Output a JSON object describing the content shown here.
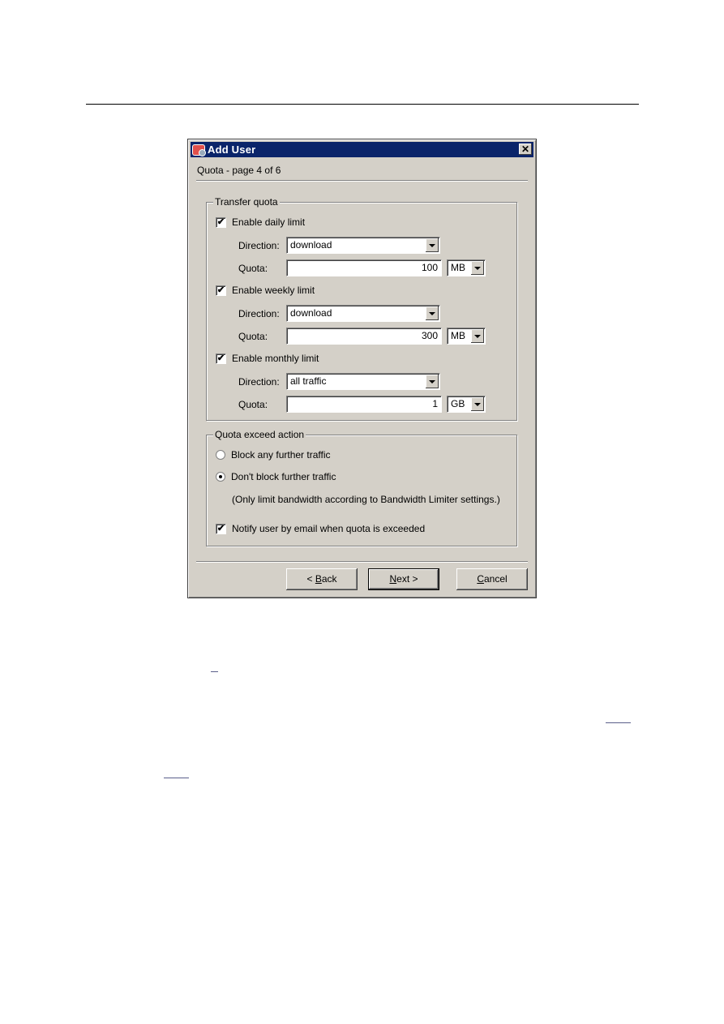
{
  "dialog": {
    "title": "Add User",
    "close_label": "✕",
    "subtitle": "Quota - page 4 of 6",
    "transfer_quota": {
      "legend": "Transfer quota",
      "limits": [
        {
          "checkbox_label": "Enable daily limit",
          "checked": true,
          "direction_label": "Direction:",
          "direction_value": "download",
          "quota_label": "Quota:",
          "quota_value": "100",
          "unit": "MB"
        },
        {
          "checkbox_label": "Enable weekly limit",
          "checked": true,
          "direction_label": "Direction:",
          "direction_value": "download",
          "quota_label": "Quota:",
          "quota_value": "300",
          "unit": "MB"
        },
        {
          "checkbox_label": "Enable monthly limit",
          "checked": true,
          "direction_label": "Direction:",
          "direction_value": "all traffic",
          "quota_label": "Quota:",
          "quota_value": "1",
          "unit": "GB"
        }
      ]
    },
    "exceed_action": {
      "legend": "Quota exceed action",
      "options": [
        {
          "label": "Block any further traffic",
          "selected": false
        },
        {
          "label": "Don't block further traffic",
          "selected": true
        }
      ],
      "note": "(Only limit bandwidth according to Bandwidth Limiter settings.)",
      "notify_label": "Notify user by email when quota is exceeded",
      "notify_checked": true
    },
    "buttons": {
      "back": {
        "prefix": "< ",
        "accel": "B",
        "rest": "ack"
      },
      "next": {
        "accel": "N",
        "rest": "ext >"
      },
      "cancel": {
        "accel": "C",
        "rest": "ancel"
      }
    },
    "check_glyph": "✔"
  }
}
